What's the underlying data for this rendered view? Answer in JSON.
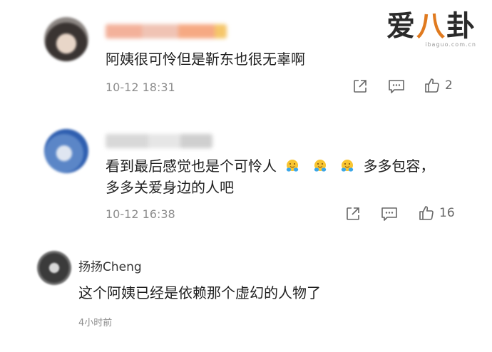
{
  "watermark": {
    "logo_text": "爱八卦",
    "url": "ibaguo.com.cn"
  },
  "comments": [
    {
      "text": "阿姨很可怜但是靳东也很无辜啊",
      "time": "10-12 18:31",
      "likes": "2"
    },
    {
      "text_line1_a": "看到最后感觉也是个可怜人",
      "text_line1_b": "多多包容，",
      "text_line2": "多多关爱身边的人吧",
      "emoji": "hug-emoji",
      "time": "10-12 16:38",
      "likes": "16"
    },
    {
      "username": "扬扬Cheng",
      "text": "这个阿姨已经是依赖那个虚幻的人物了",
      "time": "4小时前"
    }
  ],
  "icons": [
    "share-icon",
    "comment-icon",
    "like-icon"
  ]
}
